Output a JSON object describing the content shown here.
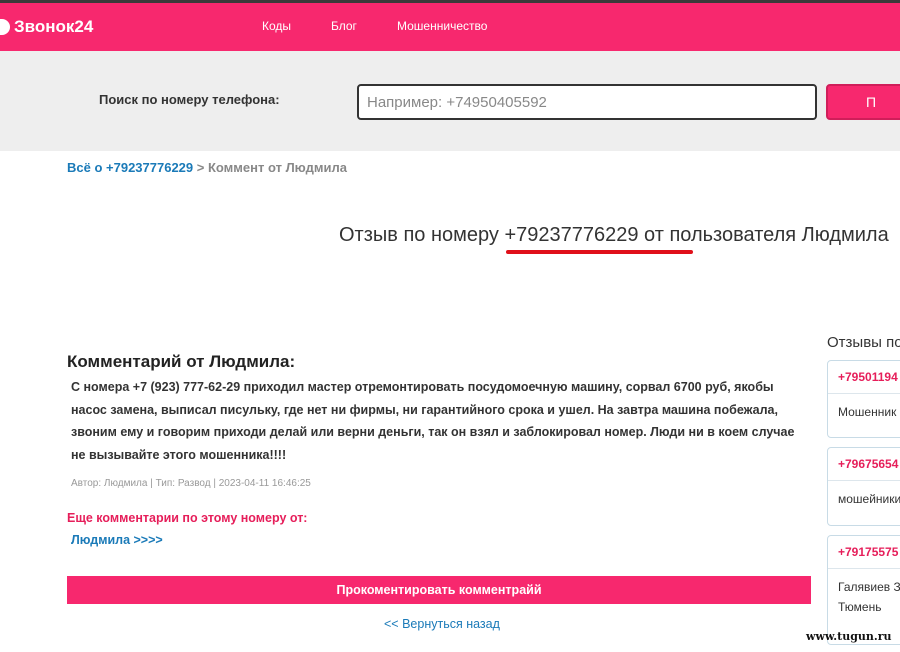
{
  "header": {
    "logo_text": "Звонок24",
    "nav": [
      "Коды",
      "Блог",
      "Мошенничество"
    ]
  },
  "search": {
    "label": "Поиск по номеру телефона:",
    "placeholder": "Например: +74950405592",
    "button_label": "П"
  },
  "breadcrumb": {
    "link": "Всё о +79237776229",
    "separator": " > ",
    "current": "Коммент от Людмила"
  },
  "title": "Отзыв по номеру +79237776229 от пользователя Людмила",
  "comment": {
    "heading": "Комментарий от Людмила:",
    "text": "С номера +7 (923) 777-62-29 приходил мастер отремонтировать посудомоечную машину, сорвал 6700 руб, якобы насос замена, выписал писульку, где нет ни фирмы, ни гарантийного срока и ушел. На завтра машина побежала, звоним ему и говорим приходи делай или верни деньги, так он взял и заблокировал номер. Люди ни в коем случае не вызывайте этого мошенника!!!!",
    "meta": "Автор: Людмила | Тип: Развод | 2023-04-11 16:46:25"
  },
  "more": {
    "label": "Еще комментарии по этому номеру от:",
    "link": "Людмила >>>>"
  },
  "actions": {
    "comment_button": "Прокоментировать комментрайй",
    "back_link": "<< Вернуться назад"
  },
  "sidebar": {
    "title": "Отзывы по",
    "cards": [
      {
        "number": "+79501194",
        "text": [
          "Мошенник с"
        ]
      },
      {
        "number": "+79675654",
        "text": [
          "мошейники"
        ]
      },
      {
        "number": "+79175575",
        "text": [
          "Галявиев З",
          "Тюмень"
        ]
      }
    ]
  },
  "watermark": "www.tugun.ru",
  "colors": {
    "accent": "#f7286e",
    "link": "#1a7ab8",
    "highlight_underline": "#e0101a"
  }
}
